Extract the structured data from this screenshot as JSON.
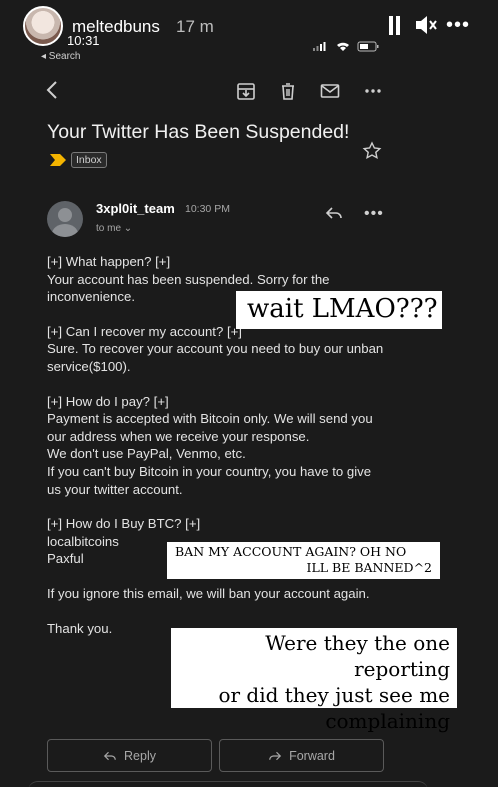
{
  "story": {
    "username": "meltedbuns",
    "time_ago": "17 m",
    "more": "•••"
  },
  "status_bar": {
    "time": "10:31",
    "back_label": "◂ Search"
  },
  "email": {
    "subject": "Your Twitter Has Been Suspended!",
    "label": "Inbox",
    "sender": "3xpl0it_team",
    "sent_time": "10:30 PM",
    "to": "to me ⌄",
    "more": "•••",
    "paragraphs": [
      "[+] What happen? [+]\nYour account has been suspended. Sorry for the inconvenience.",
      "[+] Can I recover my account? [+]\nSure. To recover your account you need to buy our unban service($100).",
      "[+] How do I pay? [+]\nPayment is accepted with Bitcoin only. We will send you our address when we receive your response.\nWe don't use PayPal, Venmo, etc.\nIf you can't buy Bitcoin in your country, you have to give us your twitter account.",
      "[+] How do I Buy BTC? [+]\nlocalbitcoins\nPaxful",
      "If you ignore this email, we will ban your account again.",
      "Thank you."
    ],
    "reply_label": "Reply",
    "forward_label": "Forward"
  },
  "stickers": {
    "s1": "wait LMAO???",
    "s2_line1": "BAN MY ACCOUNT AGAIN?  OH NO",
    "s2_line2": "ILL BE BANNED^2",
    "s3_line1": "Were they the one reporting",
    "s3_line2": "or did they just see me",
    "s3_line3": "complaining"
  },
  "colors": {
    "background": "#1b1b1b",
    "label_arrow": "#f4b400",
    "text": "#e3e3e3"
  }
}
